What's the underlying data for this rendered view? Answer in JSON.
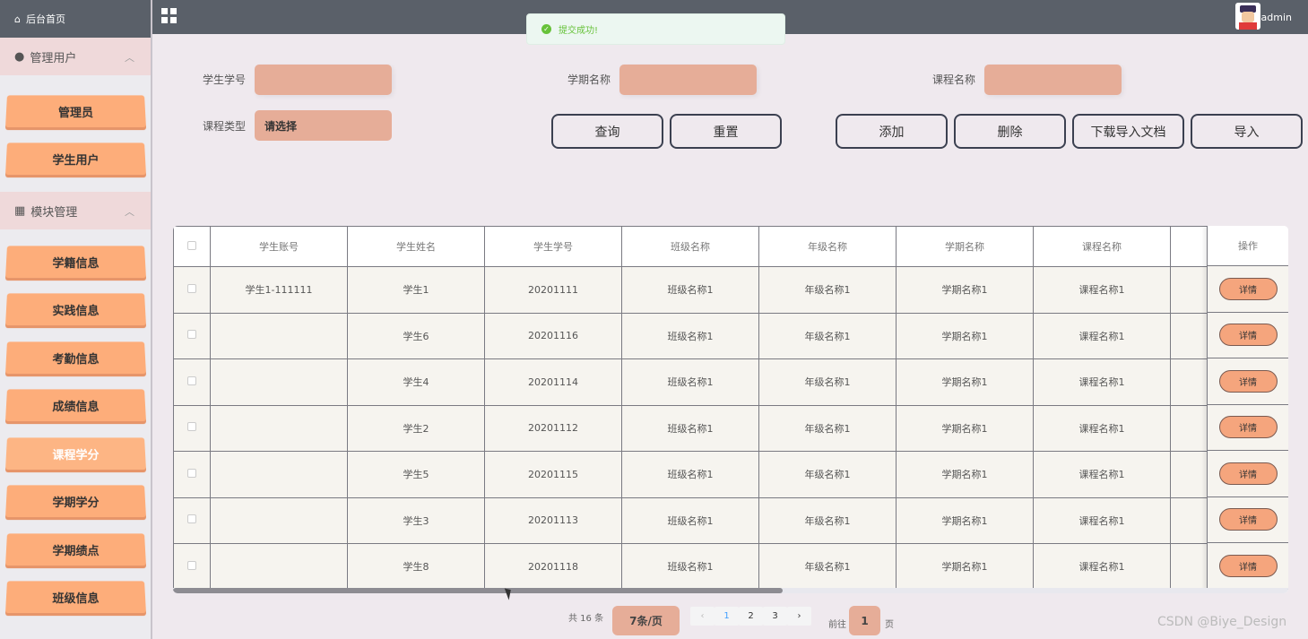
{
  "sidebar": {
    "home_label": "后台首页",
    "group1_label": "管理用户",
    "group1_items": [
      {
        "label": "管理员"
      },
      {
        "label": "学生用户"
      }
    ],
    "group2_label": "模块管理",
    "group2_items": [
      {
        "label": "学籍信息"
      },
      {
        "label": "实践信息"
      },
      {
        "label": "考勤信息"
      },
      {
        "label": "成绩信息"
      },
      {
        "label": "课程学分"
      },
      {
        "label": "学期学分"
      },
      {
        "label": "学期绩点"
      },
      {
        "label": "班级信息"
      }
    ],
    "active_item": "课程学分"
  },
  "topbar": {
    "title": "",
    "user": "admin"
  },
  "toast": {
    "message": "提交成功!"
  },
  "search": {
    "student_no_label": "学生学号",
    "term_name_label": "学期名称",
    "course_name_label": "课程名称",
    "course_type_label": "课程类型",
    "course_type_value": "请选择"
  },
  "actions": {
    "query": "查询",
    "reset": "重置",
    "add": "添加",
    "delete": "删除",
    "download": "下载导入文档",
    "import": "导入"
  },
  "table": {
    "headers": [
      "学生账号",
      "学生姓名",
      "学生学号",
      "班级名称",
      "年级名称",
      "学期名称",
      "课程名称"
    ],
    "ops_header": "操作",
    "detail_label": "详情",
    "rows": [
      [
        "学生1-111111",
        "学生1",
        "20201111",
        "班级名称1",
        "年级名称1",
        "学期名称1",
        "课程名称1"
      ],
      [
        "",
        "学生6",
        "20201116",
        "班级名称1",
        "年级名称1",
        "学期名称1",
        "课程名称1"
      ],
      [
        "",
        "学生4",
        "20201114",
        "班级名称1",
        "年级名称1",
        "学期名称1",
        "课程名称1"
      ],
      [
        "",
        "学生2",
        "20201112",
        "班级名称1",
        "年级名称1",
        "学期名称1",
        "课程名称1"
      ],
      [
        "",
        "学生5",
        "20201115",
        "班级名称1",
        "年级名称1",
        "学期名称1",
        "课程名称1"
      ],
      [
        "",
        "学生3",
        "20201113",
        "班级名称1",
        "年级名称1",
        "学期名称1",
        "课程名称1"
      ],
      [
        "",
        "学生8",
        "20201118",
        "班级名称1",
        "年级名称1",
        "学期名称1",
        "课程名称1"
      ]
    ]
  },
  "pager": {
    "total": "共 16 条",
    "page_size": "7条/页",
    "prev": "‹",
    "pages": [
      "1",
      "2",
      "3"
    ],
    "current_page": "1",
    "next": "›",
    "goto_label": "前往",
    "goto_value": "1",
    "page_suffix": "页"
  },
  "watermark": "CSDN @Biye_Design",
  "colors": {
    "accent": "#fdad7a",
    "input_bg": "#e6ad98",
    "topbar": "#5a6069",
    "success": "#67c23a"
  }
}
